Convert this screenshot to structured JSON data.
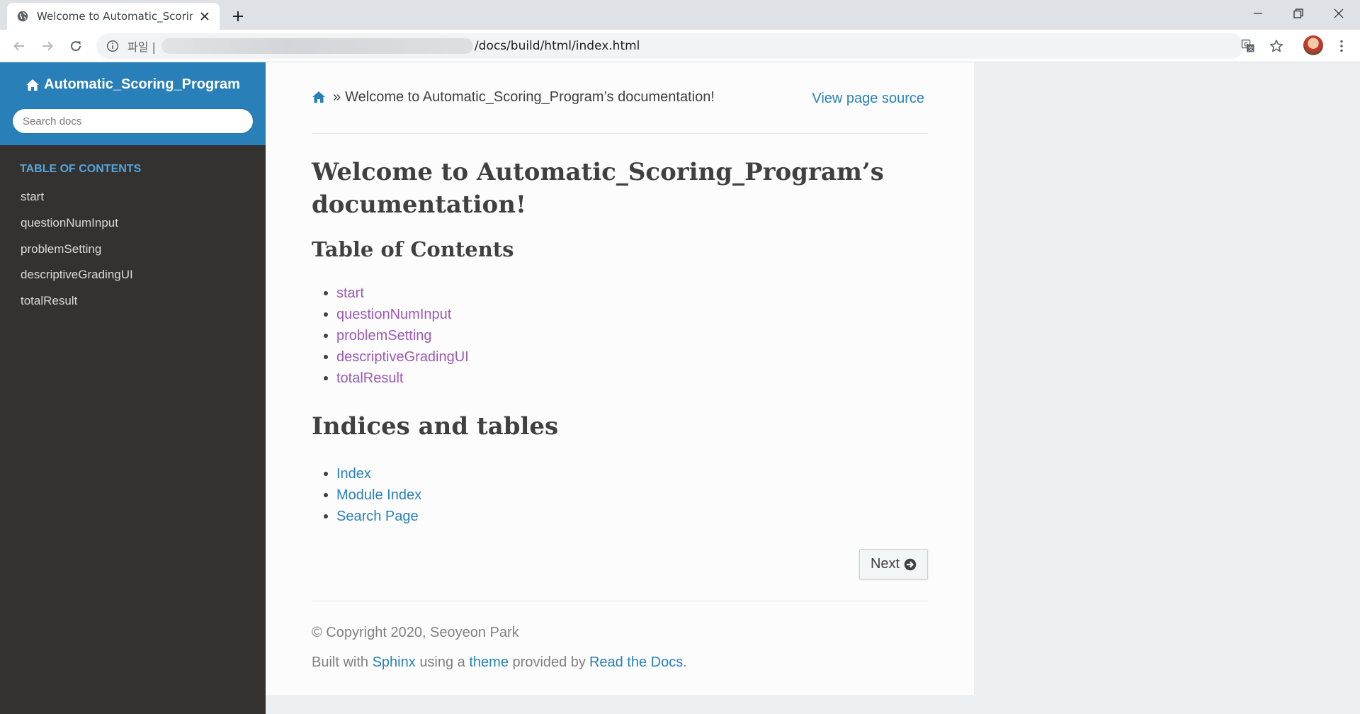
{
  "browser": {
    "tab_title": "Welcome to Automatic_Scoring",
    "omnibox_label": "파일 |",
    "url_visible": "/docs/build/html/index.html"
  },
  "sidebar": {
    "brand": "Automatic_Scoring_Program",
    "search_placeholder": "Search docs",
    "caption": "TABLE OF CONTENTS",
    "items": [
      "start",
      "questionNumInput",
      "problemSetting",
      "descriptiveGradingUI",
      "totalResult"
    ]
  },
  "breadcrumb": {
    "separator": "»",
    "current": "Welcome to Automatic_Scoring_Program’s documentation!",
    "view_source": "View page source"
  },
  "main": {
    "title": "Welcome to Automatic_Scoring_Program’s documentation!",
    "toc_heading": "Table of Contents",
    "toc_links": [
      "start",
      "questionNumInput",
      "problemSetting",
      "descriptiveGradingUI",
      "totalResult"
    ],
    "indices_heading": "Indices and tables",
    "index_links": [
      "Index",
      "Module Index",
      "Search Page"
    ],
    "next_label": "Next"
  },
  "footer": {
    "copyright": "© Copyright 2020, Seoyeon Park",
    "built_prefix": "Built with",
    "sphinx": "Sphinx",
    "using_a": "using a",
    "theme": "theme",
    "provided_by": "provided by",
    "rtd": "Read the Docs",
    "period": "."
  },
  "colors": {
    "sidebar_head": "#2980b9",
    "sidebar_bg": "#343131",
    "link": "#2980b9",
    "visited_link": "#9b59b6",
    "caption": "#55a5d9"
  }
}
